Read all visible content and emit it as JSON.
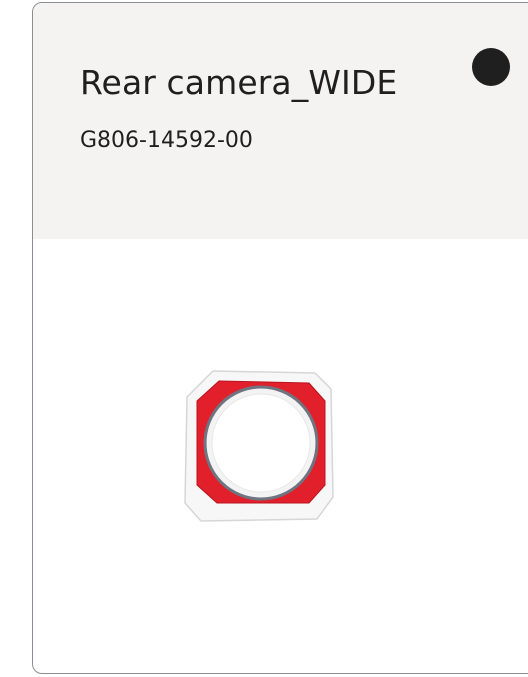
{
  "card": {
    "title": "Rear camera_WIDE",
    "part_number": "G806-14592-00",
    "status_indicator": "filled-dot",
    "image": {
      "subject": "camera-lens-cover",
      "colors": {
        "frame": "#e2202c",
        "lens": "#f3f3f3",
        "backing": "#ececec"
      }
    }
  }
}
